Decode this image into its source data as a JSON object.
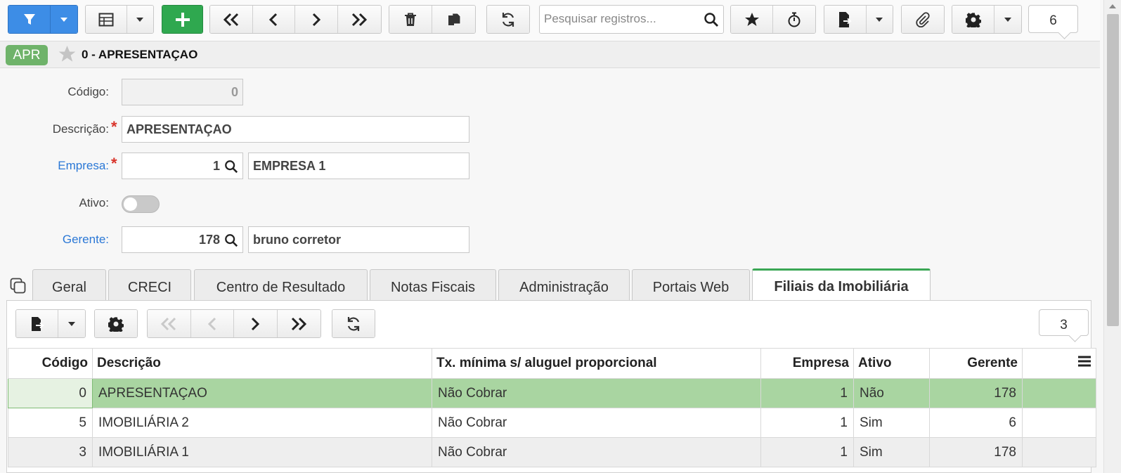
{
  "toolbar": {
    "search_placeholder": "Pesquisar registros...",
    "record_count": "6"
  },
  "titlebar": {
    "badge": "APR",
    "title": "0 - APRESENTAÇAO"
  },
  "form": {
    "codigo_label": "Código:",
    "codigo_value": "0",
    "descricao_label": "Descrição:",
    "descricao_value": "APRESENTAÇAO",
    "empresa_label": "Empresa:",
    "empresa_code": "1",
    "empresa_name": "EMPRESA 1",
    "ativo_label": "Ativo:",
    "gerente_label": "Gerente:",
    "gerente_code": "178",
    "gerente_name": "bruno corretor"
  },
  "tabs": [
    {
      "label": "Geral"
    },
    {
      "label": "CRECI"
    },
    {
      "label": "Centro de Resultado"
    },
    {
      "label": "Notas Fiscais"
    },
    {
      "label": "Administração"
    },
    {
      "label": "Portais Web"
    },
    {
      "label": "Filiais da Imobiliária"
    }
  ],
  "grid": {
    "record_count": "3",
    "columns": [
      "Código",
      "Descrição",
      "Tx. mínima s/ aluguel proporcional",
      "Empresa",
      "Ativo",
      "Gerente"
    ],
    "rows": [
      {
        "codigo": "0",
        "descricao": "APRESENTAÇAO",
        "tx": "Não Cobrar",
        "empresa": "1",
        "ativo": "Não",
        "gerente": "178"
      },
      {
        "codigo": "5",
        "descricao": "IMOBILIÁRIA 2",
        "tx": "Não Cobrar",
        "empresa": "1",
        "ativo": "Sim",
        "gerente": "6"
      },
      {
        "codigo": "3",
        "descricao": "IMOBILIÁRIA 1",
        "tx": "Não Cobrar",
        "empresa": "1",
        "ativo": "Sim",
        "gerente": "178"
      }
    ]
  },
  "colors": {
    "primary": "#3d8de6",
    "add": "#2fa84f",
    "badge": "#6fb36a",
    "selected_row": "#a9d5a1",
    "link": "#2b78d6",
    "required": "#d9342b"
  }
}
